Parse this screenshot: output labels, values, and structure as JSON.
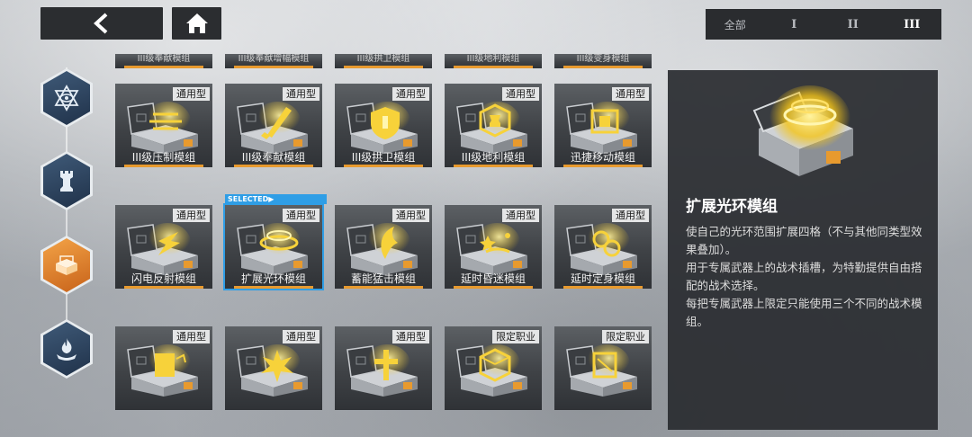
{
  "nav": {
    "back_icon": "chevron-left-icon",
    "home_icon": "home-icon"
  },
  "tier_filter": [
    "全部",
    "I",
    "II",
    "III"
  ],
  "tier_active": "III",
  "categories": [
    {
      "icon": "star-eye-icon",
      "active": false
    },
    {
      "icon": "rook-icon",
      "active": false
    },
    {
      "icon": "module-box-icon",
      "active": true
    },
    {
      "icon": "flame-emblem-icon",
      "active": false
    }
  ],
  "partial_row": [
    "III级奉献模组",
    "III级奉献增幅模组",
    "III级拱卫模组",
    "III级地利模组",
    "III级变身模组"
  ],
  "modules": [
    {
      "tag": "通用型",
      "name": "III级压制模组",
      "symbol": "lines"
    },
    {
      "tag": "通用型",
      "name": "III级奉献模组",
      "symbol": "sword"
    },
    {
      "tag": "通用型",
      "name": "III级拱卫模组",
      "symbol": "shield"
    },
    {
      "tag": "通用型",
      "name": "III级地利模组",
      "symbol": "hexagon"
    },
    {
      "tag": "通用型",
      "name": "迅捷移动模组",
      "symbol": "square"
    },
    {
      "tag": "通用型",
      "name": "闪电反射模组",
      "symbol": "bolt"
    },
    {
      "tag": "通用型",
      "name": "扩展光环模组",
      "symbol": "ring",
      "selected": true
    },
    {
      "tag": "通用型",
      "name": "蓄能猛击模组",
      "symbol": "fan"
    },
    {
      "tag": "通用型",
      "name": "延时昏迷模组",
      "symbol": "stars"
    },
    {
      "tag": "通用型",
      "name": "延时定身模组",
      "symbol": "chain"
    },
    {
      "tag": "通用型",
      "name": "",
      "symbol": "card"
    },
    {
      "tag": "通用型",
      "name": "",
      "symbol": "burst"
    },
    {
      "tag": "通用型",
      "name": "",
      "symbol": "cross"
    },
    {
      "tag": "限定职业",
      "name": "",
      "symbol": "cube"
    },
    {
      "tag": "限定职业",
      "name": "",
      "symbol": "cube2"
    }
  ],
  "selected_label": "SELECTED▶",
  "detail": {
    "title": "扩展光环模组",
    "desc": [
      "使自己的光环范围扩展四格（不与其他同类型效果叠加）。",
      "用于专属武器上的战术插槽，为特勤提供自由搭配的战术选择。",
      "每把专属武器上限定只能使用三个不同的战术模组。"
    ]
  },
  "colors": {
    "accent": "#e89a2e",
    "selected": "#2f9ee6",
    "active_category": "#e8862a"
  }
}
